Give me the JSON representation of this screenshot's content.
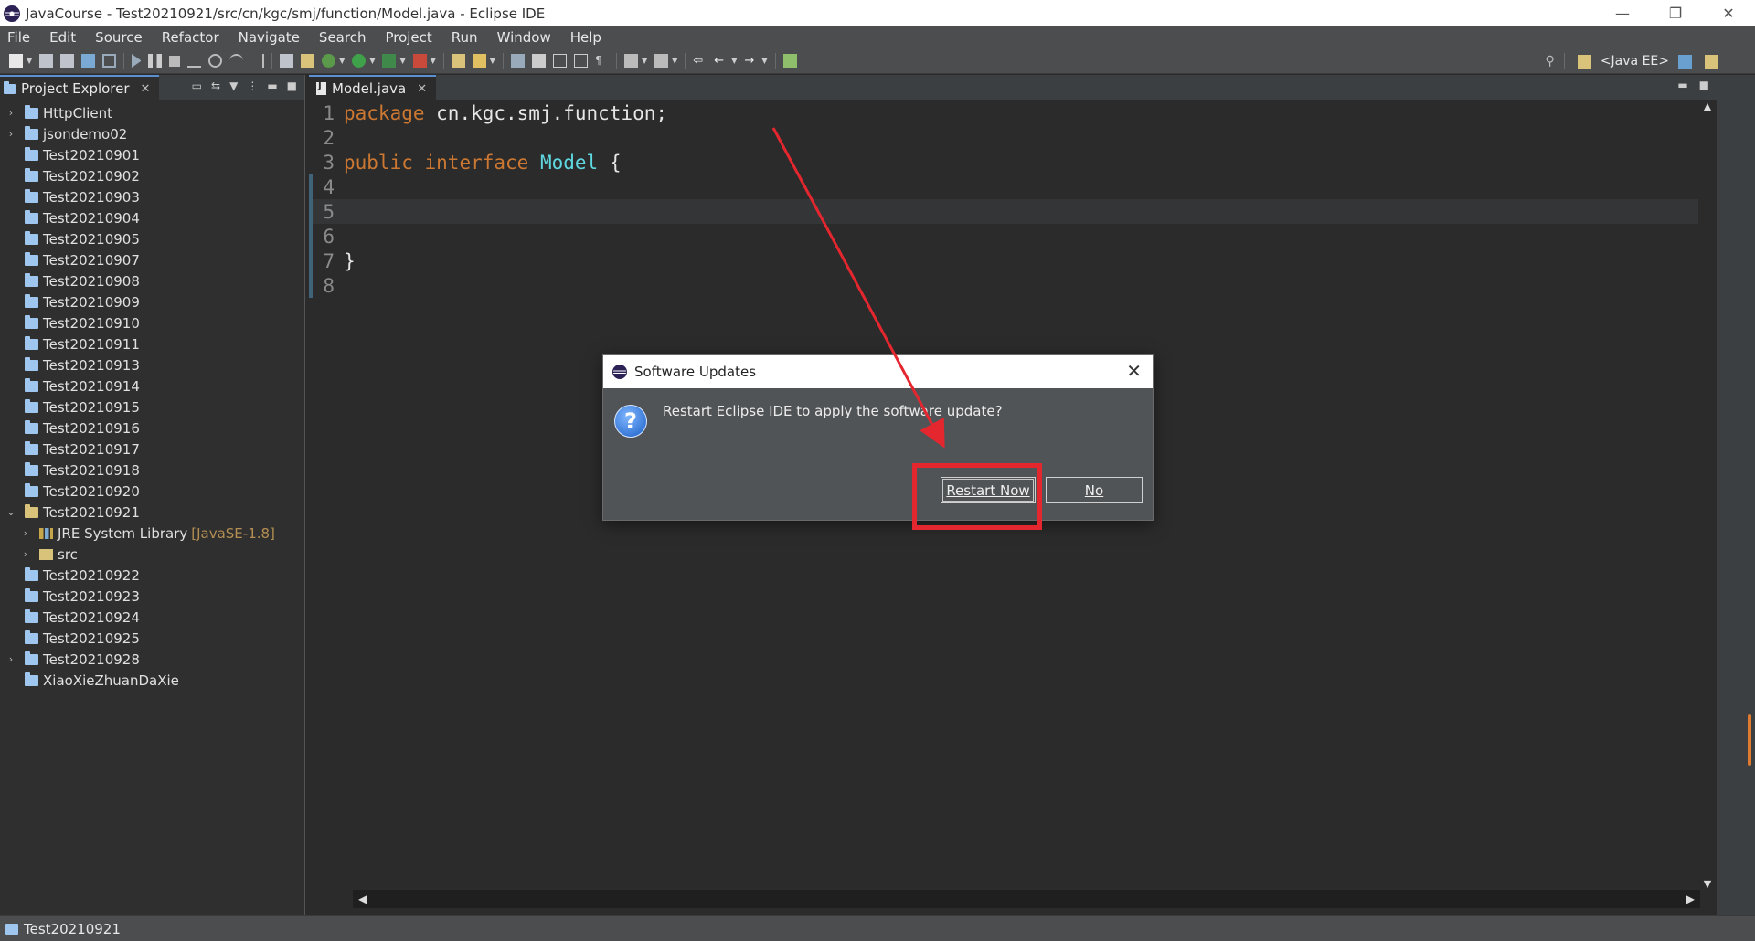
{
  "window": {
    "title": "JavaCourse - Test20210921/src/cn/kgc/smj/function/Model.java - Eclipse IDE",
    "minimize": "—",
    "restore": "❐",
    "close": "✕"
  },
  "menu": [
    "File",
    "Edit",
    "Source",
    "Refactor",
    "Navigate",
    "Search",
    "Project",
    "Run",
    "Window",
    "Help"
  ],
  "toolbar": {
    "perspective": "<Java EE>"
  },
  "project_explorer": {
    "tab_label": "Project Explorer",
    "items": [
      {
        "label": "HttpClient",
        "twisty": "›",
        "icon": "project-icon"
      },
      {
        "label": "jsondemo02",
        "twisty": "›",
        "icon": "project-icon"
      },
      {
        "label": "Test20210901",
        "twisty": "",
        "icon": "folder-icon"
      },
      {
        "label": "Test20210902",
        "twisty": "",
        "icon": "folder-icon"
      },
      {
        "label": "Test20210903",
        "twisty": "",
        "icon": "folder-icon"
      },
      {
        "label": "Test20210904",
        "twisty": "",
        "icon": "folder-icon"
      },
      {
        "label": "Test20210905",
        "twisty": "",
        "icon": "folder-icon"
      },
      {
        "label": "Test20210907",
        "twisty": "",
        "icon": "folder-icon"
      },
      {
        "label": "Test20210908",
        "twisty": "",
        "icon": "folder-icon"
      },
      {
        "label": "Test20210909",
        "twisty": "",
        "icon": "folder-icon"
      },
      {
        "label": "Test20210910",
        "twisty": "",
        "icon": "folder-icon"
      },
      {
        "label": "Test20210911",
        "twisty": "",
        "icon": "folder-icon"
      },
      {
        "label": "Test20210913",
        "twisty": "",
        "icon": "folder-icon"
      },
      {
        "label": "Test20210914",
        "twisty": "",
        "icon": "folder-icon"
      },
      {
        "label": "Test20210915",
        "twisty": "",
        "icon": "folder-icon"
      },
      {
        "label": "Test20210916",
        "twisty": "",
        "icon": "folder-icon"
      },
      {
        "label": "Test20210917",
        "twisty": "",
        "icon": "folder-icon"
      },
      {
        "label": "Test20210918",
        "twisty": "",
        "icon": "folder-icon"
      },
      {
        "label": "Test20210920",
        "twisty": "",
        "icon": "folder-icon"
      },
      {
        "label": "Test20210921",
        "twisty": "⌄",
        "icon": "project-open-icon"
      },
      {
        "label": "JRE System Library",
        "twisty": "›",
        "icon": "library-icon",
        "decoration": "[JavaSE-1.8]",
        "child": true
      },
      {
        "label": "src",
        "twisty": "›",
        "icon": "source-folder-icon",
        "child": true
      },
      {
        "label": "Test20210922",
        "twisty": "",
        "icon": "folder-icon"
      },
      {
        "label": "Test20210923",
        "twisty": "",
        "icon": "folder-icon"
      },
      {
        "label": "Test20210924",
        "twisty": "",
        "icon": "folder-icon"
      },
      {
        "label": "Test20210925",
        "twisty": "",
        "icon": "folder-icon"
      },
      {
        "label": "Test20210928",
        "twisty": "›",
        "icon": "project-icon"
      },
      {
        "label": "XiaoXieZhuanDaXie",
        "twisty": "",
        "icon": "folder-icon"
      }
    ]
  },
  "editor": {
    "tab_label": "Model.java",
    "lines": [
      {
        "n": "1",
        "tokens": [
          {
            "t": "package",
            "c": "kw"
          },
          {
            "t": " cn.kgc.smj.function;",
            "c": "plain"
          }
        ]
      },
      {
        "n": "2",
        "tokens": []
      },
      {
        "n": "3",
        "tokens": [
          {
            "t": "public",
            "c": "kw"
          },
          {
            "t": " ",
            "c": "plain"
          },
          {
            "t": "interface",
            "c": "kw"
          },
          {
            "t": " ",
            "c": "plain"
          },
          {
            "t": "Model",
            "c": "typ"
          },
          {
            "t": " {",
            "c": "plain"
          }
        ]
      },
      {
        "n": "4",
        "tokens": []
      },
      {
        "n": "5",
        "tokens": [],
        "active": true
      },
      {
        "n": "6",
        "tokens": []
      },
      {
        "n": "7",
        "tokens": [
          {
            "t": "}",
            "c": "plain"
          }
        ]
      },
      {
        "n": "8",
        "tokens": []
      }
    ]
  },
  "status": {
    "selection": "Test20210921"
  },
  "dialog": {
    "title": "Software Updates",
    "message": "Restart Eclipse IDE to apply the software update?",
    "restart_label": "Restart Now",
    "no_label": "No",
    "question_glyph": "?",
    "close_glyph": "✕"
  },
  "colors": {
    "annotation": "#e4272f",
    "keyword": "#cc7832",
    "type": "#5fd7e0"
  }
}
